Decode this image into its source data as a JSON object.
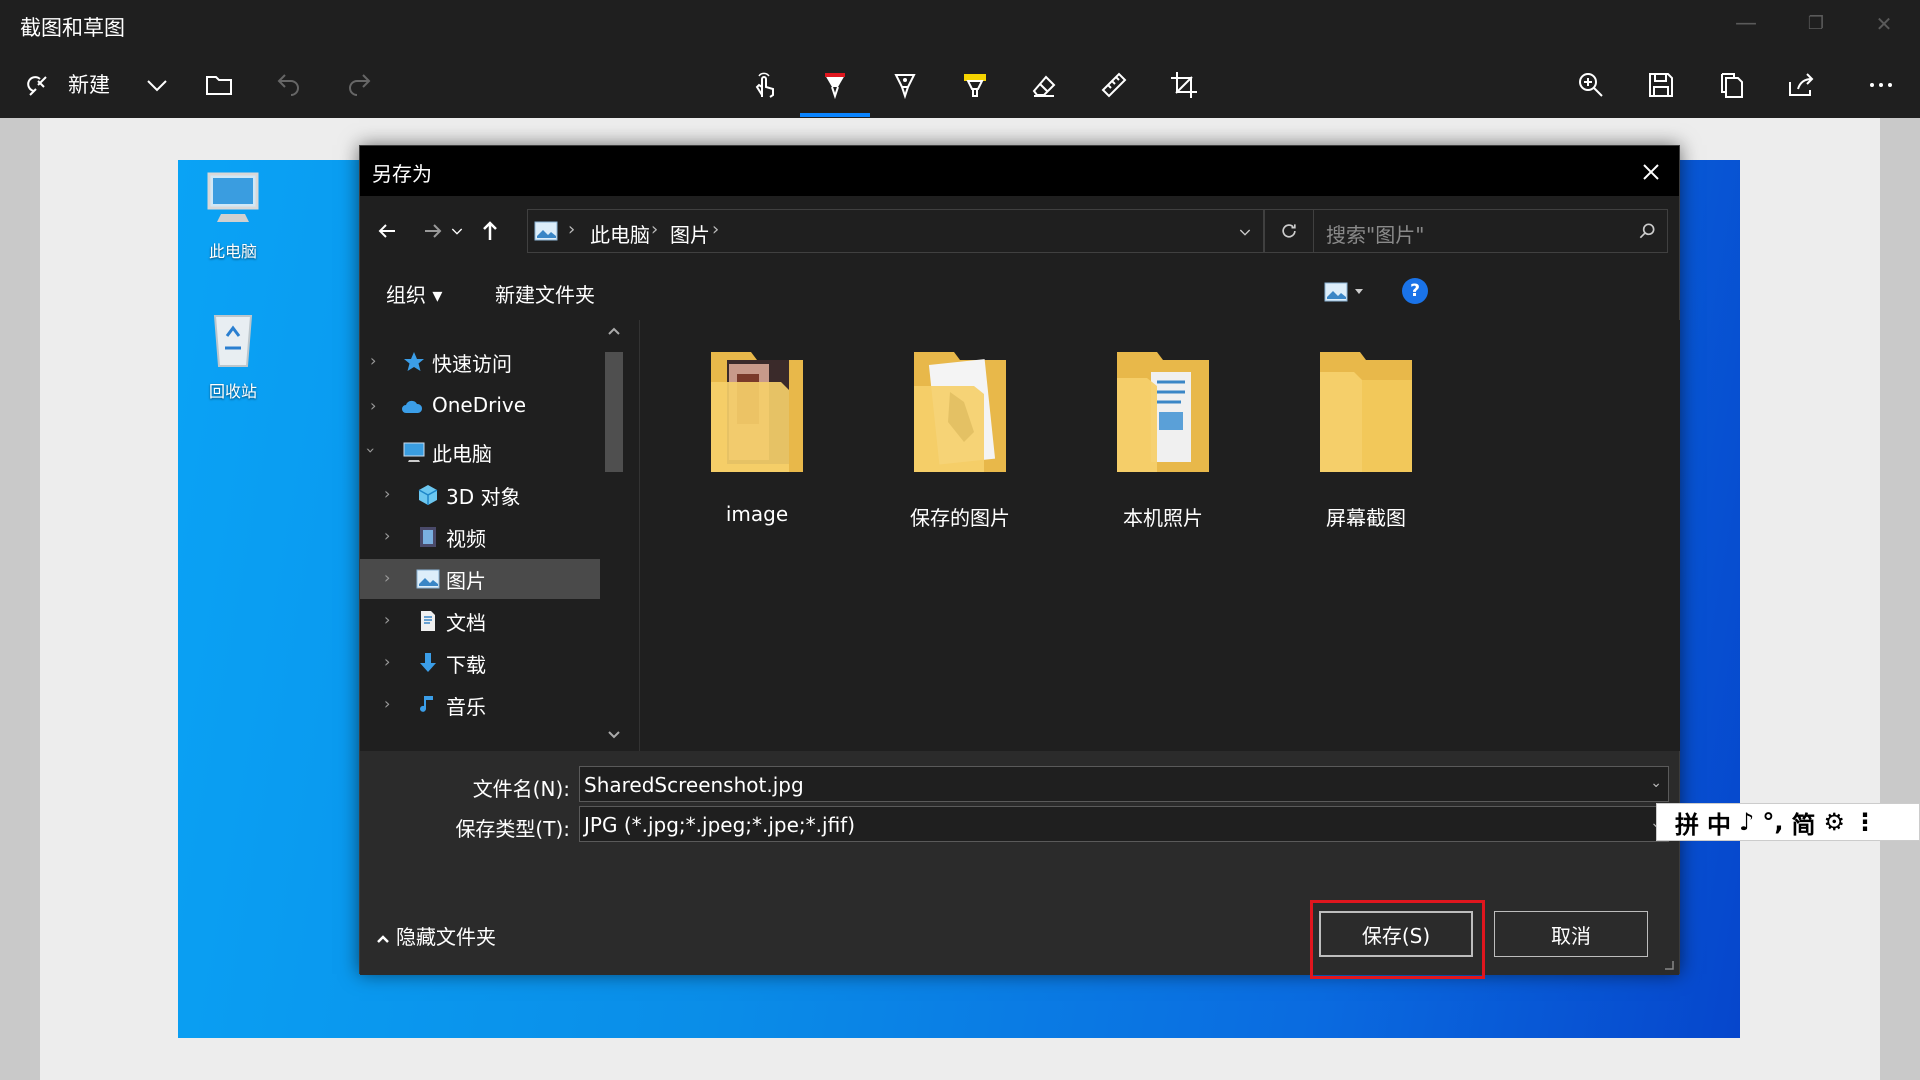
{
  "app": {
    "title": "截图和草图",
    "window_controls": [
      "—",
      "❐",
      "✕"
    ]
  },
  "toolbar": {
    "new_label": "新建",
    "icons": [
      "new-snip-icon",
      "chevron-down-icon",
      "open-folder-icon",
      "undo-icon",
      "redo-icon",
      "touch-writing-icon",
      "ballpoint-pen-icon",
      "pencil-icon",
      "highlighter-icon",
      "eraser-icon",
      "ruler-icon",
      "crop-icon",
      "zoom-icon",
      "save-icon",
      "copy-icon",
      "share-icon",
      "more-icon"
    ],
    "colors": {
      "pen": "#e0161e",
      "highlighter": "#f5d300",
      "active_underline": "#0a84ff"
    }
  },
  "desktop": {
    "icons": [
      {
        "label": "此电脑"
      },
      {
        "label": "回收站"
      }
    ]
  },
  "dialog": {
    "title": "另存为",
    "breadcrumb": [
      "此电脑",
      "图片"
    ],
    "search_placeholder": "搜索\"图片\"",
    "commands": {
      "organize": "组织 ▾",
      "new_folder": "新建文件夹",
      "help": "?"
    },
    "tree": [
      {
        "label": "快速访问",
        "icon": "star-icon"
      },
      {
        "label": "OneDrive",
        "icon": "cloud-icon"
      },
      {
        "label": "此电脑",
        "icon": "computer-icon"
      },
      {
        "label": "3D 对象",
        "icon": "cube-icon"
      },
      {
        "label": "视频",
        "icon": "video-icon"
      },
      {
        "label": "图片",
        "icon": "pictures-icon"
      },
      {
        "label": "文档",
        "icon": "document-icon"
      },
      {
        "label": "下载",
        "icon": "download-icon"
      },
      {
        "label": "音乐",
        "icon": "music-icon"
      }
    ],
    "folders": [
      {
        "label": "image"
      },
      {
        "label": "保存的图片"
      },
      {
        "label": "本机照片"
      },
      {
        "label": "屏幕截图"
      }
    ],
    "filename_label": "文件名(N):",
    "filename_value": "SharedScreenshot.jpg",
    "filetype_label": "保存类型(T):",
    "filetype_value": "JPG (*.jpg;*.jpeg;*.jpe;*.jfif)",
    "hide_folders": "隐藏文件夹",
    "save": "保存(S)",
    "cancel": "取消"
  },
  "ime": {
    "items": [
      "拼",
      "中",
      "♪",
      "°,",
      "简",
      "⚙",
      "⋮"
    ]
  }
}
